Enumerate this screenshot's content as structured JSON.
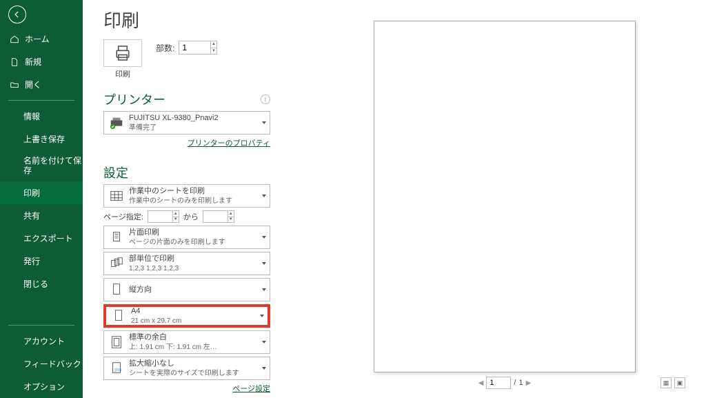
{
  "sidebar": {
    "items": [
      {
        "label": "ホーム",
        "icon": "home"
      },
      {
        "label": "新規",
        "icon": "file"
      },
      {
        "label": "開く",
        "icon": "open"
      }
    ],
    "items2": [
      {
        "label": "情報"
      },
      {
        "label": "上書き保存"
      },
      {
        "label": "名前を付けて保存"
      },
      {
        "label": "印刷",
        "selected": true
      },
      {
        "label": "共有"
      },
      {
        "label": "エクスポート"
      },
      {
        "label": "発行"
      },
      {
        "label": "閉じる"
      }
    ],
    "items3": [
      {
        "label": "アカウント"
      },
      {
        "label": "フィードバック"
      },
      {
        "label": "オプション"
      }
    ]
  },
  "page_title": "印刷",
  "print_button": "印刷",
  "copies_label": "部数:",
  "copies_value": "1",
  "printer_section": "プリンター",
  "printer": {
    "name": "FUJITSU XL-9380_Pnavi2",
    "status": "準備完了"
  },
  "printer_props_link": "プリンターのプロパティ",
  "settings_section": "設定",
  "page_range": {
    "label": "ページ指定:",
    "val1": "",
    "mid": "から",
    "val2": ""
  },
  "dd_area": {
    "t": "作業中のシートを印刷",
    "s": "作業中のシートのみを印刷します"
  },
  "dd_side": {
    "t": "片面印刷",
    "s": "ページの片面のみを印刷します"
  },
  "dd_collate": {
    "t": "部単位で印刷",
    "s": "1,2,3   1,2,3   1,2,3"
  },
  "dd_orient": {
    "t": "縦方向",
    "s": ""
  },
  "dd_size": {
    "t": "A4",
    "s": "21 cm x 29.7 cm"
  },
  "dd_margins": {
    "t": "標準の余白",
    "s": "上: 1.91 cm 下: 1.91 cm 左…"
  },
  "dd_scale": {
    "t": "拡大縮小なし",
    "s": "シートを実際のサイズで印刷します"
  },
  "page_setup_link": "ページ設定",
  "pager": {
    "current": "1",
    "sep": "/",
    "total": "1"
  }
}
